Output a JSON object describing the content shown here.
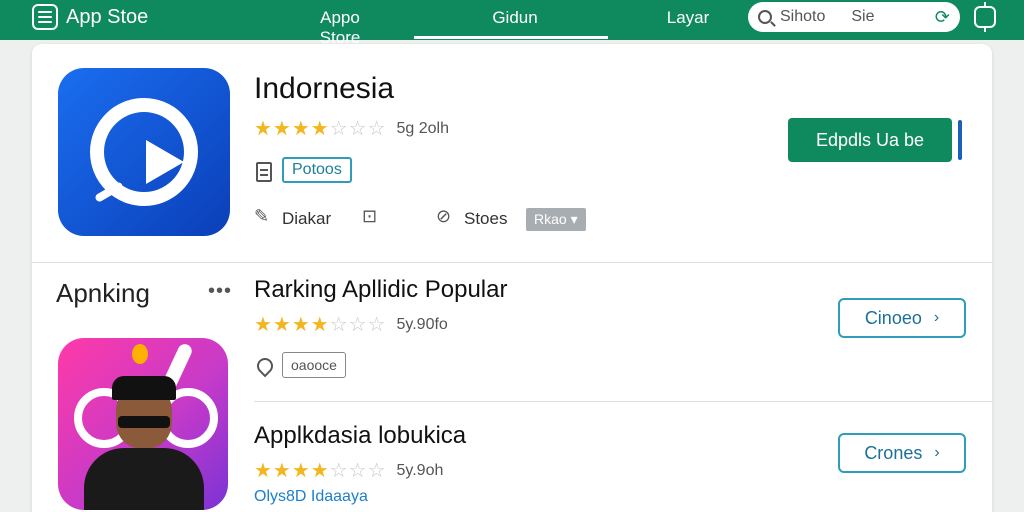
{
  "topbar": {
    "brand": "App Stoe",
    "tabs": [
      {
        "label": "Appo Store"
      },
      {
        "label": "Gidun"
      },
      {
        "label": "Layar"
      }
    ],
    "search": {
      "value": "Sihoto",
      "extra": "Sie",
      "refresh_icon": "refresh-icon"
    }
  },
  "featured": {
    "title": "Indornesia",
    "stars": "★★★★",
    "stars_empty": "☆☆☆",
    "rating_text": "5g 2olh",
    "tag": "Potoos",
    "meta_left": "Diakar",
    "meta_mid": "Stoes",
    "dropdown": "Rkao ▾",
    "install_label": "Edpdls Ua be"
  },
  "ranking": {
    "section_title": "Apnking",
    "items": [
      {
        "title": "Rarking Apllidic Popular",
        "stars": "★★★★",
        "stars_empty": "☆☆☆",
        "rating_text": "5y.90fo",
        "tag": "oaooce",
        "button": "Cinoeo"
      },
      {
        "title": "Applkdasia lobukica",
        "stars": "★★★★",
        "stars_empty": "☆☆☆",
        "rating_text": "5y.9oh",
        "link": "Olys8D Idaaaya",
        "button": "Crones"
      }
    ]
  },
  "colors": {
    "accent": "#0f8a5f",
    "star": "#f3b61f",
    "outline": "#2f9db8"
  }
}
